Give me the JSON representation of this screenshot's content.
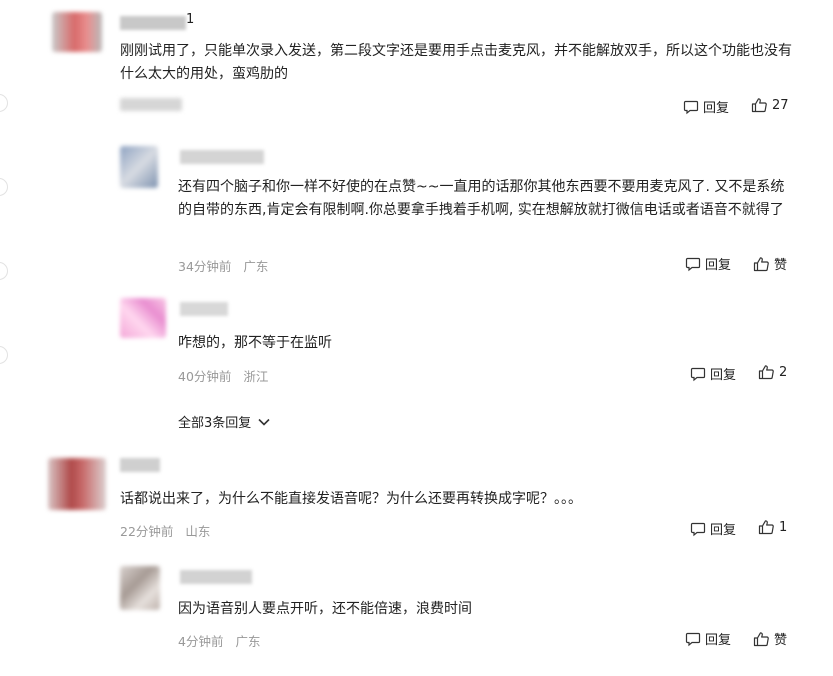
{
  "comments": [
    {
      "text": "刚刚试用了，只能单次录入发送，第二段文字还是要用手点击麦克风，并不能解放双手，所以这个功能也没有什么太大的用处，蛮鸡肋的",
      "username_tail": "1",
      "reply_label": "回复",
      "like_count": "27"
    },
    {
      "text": "还有四个脑子和你一样不好使的在点赞~~一直用的话那你其他东西要不要用麦克风了. 又不是系统的自带的东西,肯定会有限制啊.你总要拿手拽着手机啊, 实在想解放就打微信电话或者语音不就得了",
      "time": "34分钟前",
      "location": "广东",
      "reply_label": "回复",
      "like_label": "赞"
    },
    {
      "text": "咋想的，那不等于在监听",
      "time": "40分钟前",
      "location": "浙江",
      "reply_label": "回复",
      "like_count": "2"
    },
    {
      "text": "话都说出来了，为什么不能直接发语音呢？为什么还要再转换成字呢？。。。",
      "time": "22分钟前",
      "location": "山东",
      "reply_label": "回复",
      "like_count": "1"
    },
    {
      "text": "因为语音别人要点开听，还不能倍速，浪费时间",
      "time": "4分钟前",
      "location": "广东",
      "reply_label": "回复",
      "like_label": "赞"
    }
  ],
  "expand_replies_label": "全部3条回复",
  "icons": {
    "reply": "comment-bubble-icon",
    "like": "thumbs-up-icon",
    "expand": "chevron-down-icon"
  },
  "colors": {
    "meta_gray": "#999999",
    "text": "#222222"
  }
}
